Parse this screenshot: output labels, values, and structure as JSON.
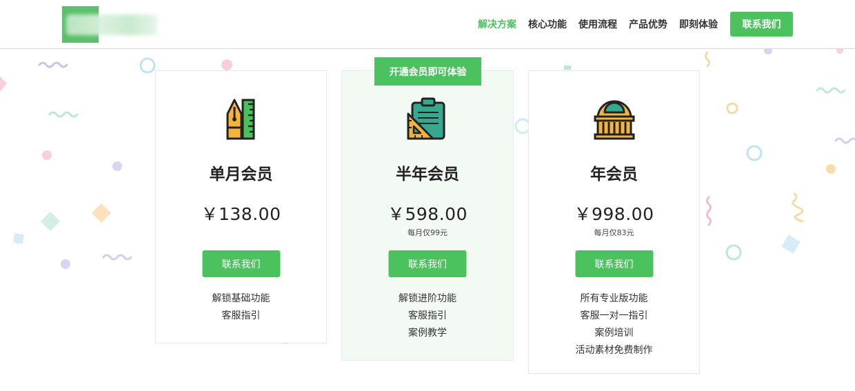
{
  "header": {
    "nav": [
      "解决方案",
      "核心功能",
      "使用流程",
      "产品优势",
      "即刻体验"
    ],
    "active_index": 0,
    "contact_label": "联系我们"
  },
  "ribbon": "开通会员即可体验",
  "plans": [
    {
      "title": "单月会员",
      "price": "￥138.00",
      "sub": "",
      "button": "联系我们",
      "icon": "pen-ruler-icon",
      "features": [
        "解锁基础功能",
        "客服指引"
      ]
    },
    {
      "title": "半年会员",
      "price": "￥598.00",
      "sub": "每月仅99元",
      "button": "联系我们",
      "icon": "clipboard-set-square-icon",
      "features": [
        "解锁进阶功能",
        "客服指引",
        "案例教学"
      ]
    },
    {
      "title": "年会员",
      "price": "￥998.00",
      "sub": "每月仅83元",
      "button": "联系我们",
      "icon": "museum-building-icon",
      "features": [
        "所有专业版功能",
        "客服一对一指引",
        "案例培训",
        "活动素材免费制作"
      ]
    }
  ],
  "colors": {
    "accent": "#4cc25e",
    "highlight_bg": "#f2faf3"
  }
}
